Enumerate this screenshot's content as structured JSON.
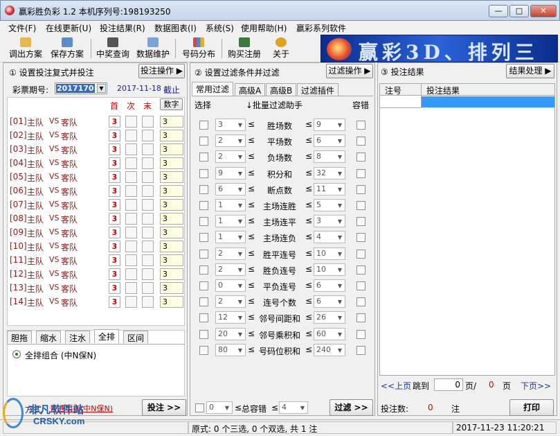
{
  "window": {
    "title": "赢彩胜负彩 1.2  本机序列号:198193250",
    "min": "—",
    "max": "□",
    "close": "✕"
  },
  "menu": [
    "文件(F)",
    "在线更新(U)",
    "投注结果(R)",
    "数据图表(I)",
    "系统(S)",
    "使用帮助(H)",
    "赢彩系列软件"
  ],
  "toolbar": [
    {
      "label": "调出方案",
      "icon": "folder-icon",
      "color": "#e8b84a"
    },
    {
      "label": "保存方案",
      "icon": "save-icon",
      "color": "#5e8cc8"
    },
    {
      "label": "中奖查询",
      "icon": "binoculars-icon",
      "color": "#555"
    },
    {
      "label": "数据维护",
      "icon": "database-icon",
      "color": "#7da3d6"
    },
    {
      "label": "号码分布",
      "icon": "bar-chart-icon",
      "color": "#d04a4a"
    },
    {
      "label": "购买注册",
      "icon": "cart-icon",
      "color": "#3a7a3a"
    },
    {
      "label": "关于",
      "icon": "help-icon",
      "color": "#e0a020"
    }
  ],
  "banner": {
    "text": "赢彩3D、排列三"
  },
  "left": {
    "header": "① 设置投注复式并投注",
    "action": "投注操作 ▶",
    "period_label": "彩票期号:",
    "period": "2017170",
    "date": "2017-11-18",
    "deadline": "截止",
    "cols": {
      "first": "首",
      "second": "次",
      "last": "末",
      "digit": "数字"
    },
    "matches": [
      {
        "no": "[01]",
        "home": "主队",
        "vs": "VS",
        "away": "客队",
        "val": "3",
        "input": "3"
      },
      {
        "no": "[02]",
        "home": "主队",
        "vs": "VS",
        "away": "客队",
        "val": "3",
        "input": "3"
      },
      {
        "no": "[03]",
        "home": "主队",
        "vs": "VS",
        "away": "客队",
        "val": "3",
        "input": "3"
      },
      {
        "no": "[04]",
        "home": "主队",
        "vs": "VS",
        "away": "客队",
        "val": "3",
        "input": "3"
      },
      {
        "no": "[05]",
        "home": "主队",
        "vs": "VS",
        "away": "客队",
        "val": "3",
        "input": "3"
      },
      {
        "no": "[06]",
        "home": "主队",
        "vs": "VS",
        "away": "客队",
        "val": "3",
        "input": "3"
      },
      {
        "no": "[07]",
        "home": "主队",
        "vs": "VS",
        "away": "客队",
        "val": "3",
        "input": "3"
      },
      {
        "no": "[08]",
        "home": "主队",
        "vs": "VS",
        "away": "客队",
        "val": "3",
        "input": "3"
      },
      {
        "no": "[09]",
        "home": "主队",
        "vs": "VS",
        "away": "客队",
        "val": "3",
        "input": "3"
      },
      {
        "no": "[10]",
        "home": "主队",
        "vs": "VS",
        "away": "客队",
        "val": "3",
        "input": "3"
      },
      {
        "no": "[11]",
        "home": "主队",
        "vs": "VS",
        "away": "客队",
        "val": "3",
        "input": "3"
      },
      {
        "no": "[12]",
        "home": "主队",
        "vs": "VS",
        "away": "客队",
        "val": "3",
        "input": "3"
      },
      {
        "no": "[13]",
        "home": "主队",
        "vs": "VS",
        "away": "客队",
        "val": "3",
        "input": "3"
      },
      {
        "no": "[14]",
        "home": "主队",
        "vs": "VS",
        "away": "客队",
        "val": "3",
        "input": "3"
      }
    ],
    "tabs": [
      "胆拖",
      "缩水",
      "注水",
      "全排",
      "区间"
    ],
    "active_tab": "全排",
    "radio_label": "全排组合  (中N保N)",
    "method_label": "方式",
    "method_value": "普通明拖(中N保N)",
    "bet_button": "投注 >>"
  },
  "middle": {
    "header": "② 设置过滤条件并过滤",
    "action": "过滤操作 ▶",
    "tabs": [
      "常用过滤",
      "高级A",
      "高级B",
      "过滤插件"
    ],
    "col_select": "选择",
    "col_helper": "↓批量过滤助手",
    "col_tolerance": "容错",
    "filters": [
      {
        "min": "3",
        "name": "胜场数",
        "max": "9"
      },
      {
        "min": "2",
        "name": "平场数",
        "max": "6"
      },
      {
        "min": "2",
        "name": "负场数",
        "max": "8"
      },
      {
        "min": "9",
        "name": "积分和",
        "max": "32"
      },
      {
        "min": "6",
        "name": "断点数",
        "max": "11"
      },
      {
        "min": "1",
        "name": "主场连胜",
        "max": "5"
      },
      {
        "min": "1",
        "name": "主场连平",
        "max": "3"
      },
      {
        "min": "1",
        "name": "主场连负",
        "max": "4"
      },
      {
        "min": "2",
        "name": "胜平连号",
        "max": "10"
      },
      {
        "min": "2",
        "name": "胜负连号",
        "max": "10"
      },
      {
        "min": "0",
        "name": "平负连号",
        "max": "6"
      },
      {
        "min": "2",
        "name": "连号个数",
        "max": "6"
      },
      {
        "min": "12",
        "name": "邻号间距和",
        "max": "26"
      },
      {
        "min": "20",
        "name": "邻号乘积和",
        "max": "60"
      },
      {
        "min": "80",
        "name": "号码位积和",
        "max": "240"
      }
    ],
    "le": "≤",
    "bottom_min": "0",
    "bottom_label": "总容错",
    "bottom_max": "4",
    "filter_button": "过滤 >>"
  },
  "right": {
    "header": "③ 投注结果",
    "action": "结果处理 ▶",
    "col_no": "注号",
    "col_result": "投注结果",
    "prev": "<<上页",
    "jump": "跳到",
    "page_input": "0",
    "page_unit": "页/",
    "total_pages": "0",
    "page_word": "页",
    "next": "下页>>",
    "count_label": "投注数:",
    "count": "0",
    "count_unit": "注",
    "print_button": "打印"
  },
  "status": {
    "mid": "原式: 0 个三选, 0 个双选, 共 1 注",
    "time": "2017-11-23 11:20:21"
  },
  "watermark": {
    "cn": "非凡软件站",
    "en": "CRSKY.com"
  }
}
